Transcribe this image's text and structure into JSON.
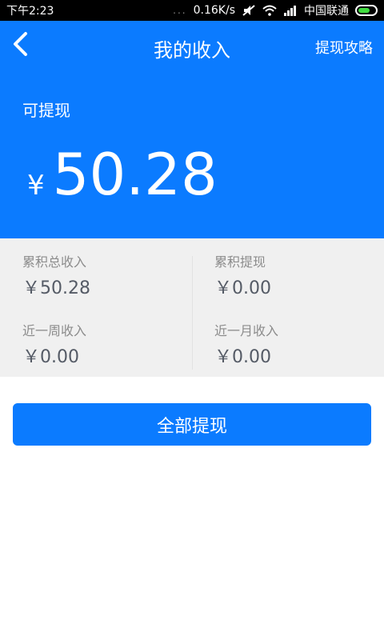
{
  "status_bar": {
    "time": "下午2:23",
    "dots": "...",
    "net_speed": "0.16K/s",
    "carrier": "中国联通",
    "icons": [
      "mute-icon",
      "wifi-icon",
      "signal-icon",
      "battery-icon"
    ]
  },
  "header": {
    "title": "我的收入",
    "back_icon": "back-arrow-icon",
    "right_link": "提现攻略"
  },
  "balance": {
    "label": "可提现",
    "currency": "¥",
    "amount": "50.28"
  },
  "stats": [
    {
      "label": "累积总收入",
      "value": "￥50.28"
    },
    {
      "label": "累积提现",
      "value": "￥0.00"
    },
    {
      "label": "近一周收入",
      "value": "￥0.00"
    },
    {
      "label": "近一月收入",
      "value": "￥0.00"
    }
  ],
  "action": {
    "withdraw_all_label": "全部提现"
  },
  "colors": {
    "primary": "#0b7bff",
    "stats_bg": "#f0f0f0",
    "label_gray": "#8c8c8c",
    "value_gray": "#555b66"
  }
}
